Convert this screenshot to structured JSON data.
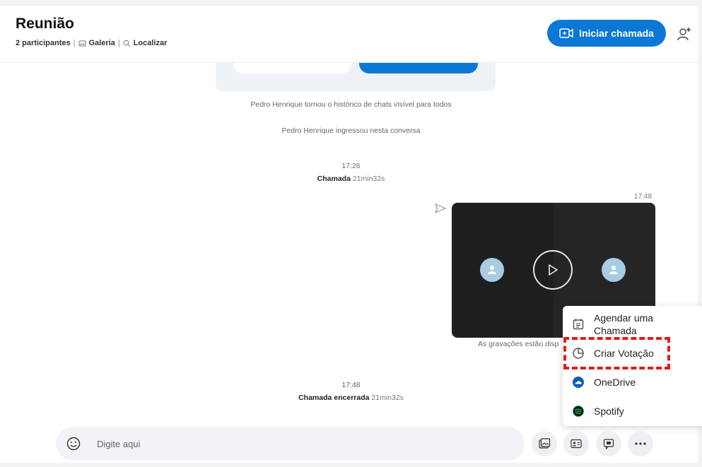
{
  "header": {
    "title": "Reunião",
    "participants": "2 participantes",
    "gallery": "Galeria",
    "find": "Localizar",
    "call_button": "Iniciar chamada"
  },
  "timeline": {
    "event1": "Pedro Henrique tornou o histórico de chats visível para todos",
    "event2": "Pedro Henrique ingressou nesta conversa",
    "call1": {
      "time": "17:26",
      "label": "Chamada",
      "duration": "21min32s"
    },
    "video_time": "17:48",
    "recordings_note": "As gravações estão disp",
    "call2": {
      "time": "17:48",
      "label": "Chamada encerrada",
      "duration": "21min32s"
    }
  },
  "menu": {
    "items": [
      {
        "label": "Agendar uma Chamada",
        "icon": "calendar-icon"
      },
      {
        "label": "Criar Votação",
        "icon": "poll-icon"
      },
      {
        "label": "OneDrive",
        "icon": "onedrive-icon"
      },
      {
        "label": "Spotify",
        "icon": "spotify-icon"
      }
    ]
  },
  "composer": {
    "placeholder": "Digite aqui"
  },
  "colors": {
    "accent": "#0b78d6",
    "highlight": "#e11b1b",
    "spotify": "#1db954",
    "onedrive": "#0a5fb4"
  }
}
